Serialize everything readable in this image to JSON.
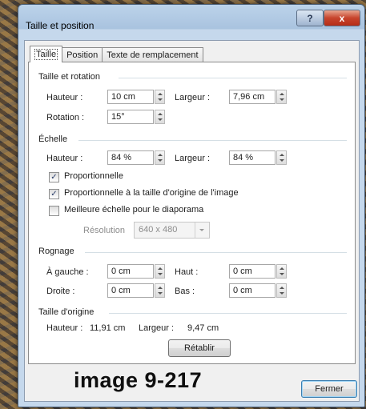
{
  "window": {
    "title": "Taille et position",
    "help_glyph": "?",
    "close_glyph": "x"
  },
  "tabs": [
    {
      "label": "Taille"
    },
    {
      "label": "Position"
    },
    {
      "label": "Texte de remplacement"
    }
  ],
  "size_rotation": {
    "heading": "Taille et rotation",
    "height_label": "Hauteur :",
    "height_value": "10 cm",
    "width_label": "Largeur :",
    "width_value": "7,96 cm",
    "rotation_label": "Rotation :",
    "rotation_value": "15°"
  },
  "scale": {
    "heading": "Échelle",
    "height_label": "Hauteur :",
    "height_value": "84 %",
    "width_label": "Largeur :",
    "width_value": "84 %",
    "lock_ratio": {
      "label": "Proportionnelle",
      "checked": true
    },
    "relative_original": {
      "label": "Proportionnelle à la taille d'origine de l'image",
      "checked": true
    },
    "best_scale": {
      "label": "Meilleure échelle pour le diaporama",
      "checked": false
    },
    "resolution_label": "Résolution",
    "resolution_value": "640 x 480"
  },
  "crop": {
    "heading": "Rognage",
    "left_label": "À gauche :",
    "left_value": "0 cm",
    "top_label": "Haut :",
    "top_value": "0 cm",
    "right_label": "Droite :",
    "right_value": "0 cm",
    "bottom_label": "Bas :",
    "bottom_value": "0 cm"
  },
  "original_size": {
    "heading": "Taille d'origine",
    "height_label": "Hauteur :",
    "height_value": "11,91 cm",
    "width_label": "Largeur :",
    "width_value": "9,47 cm",
    "reset_label": "Rétablir"
  },
  "footer": {
    "close_label": "Fermer",
    "caption": "image 9-217"
  },
  "check_glyph": "✓"
}
